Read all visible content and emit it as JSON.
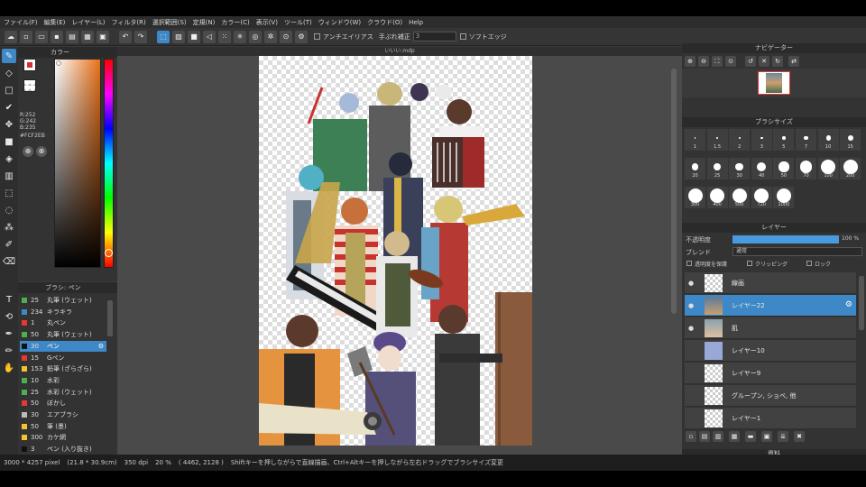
{
  "menu": [
    "ファイル(F)",
    "編集(E)",
    "レイヤー(L)",
    "フィルタ(R)",
    "選択範囲(S)",
    "定規(N)",
    "カラー(C)",
    "表示(V)",
    "ツール(T)",
    "ウィンドウ(W)",
    "クラウド(O)",
    "Help"
  ],
  "toolbar": {
    "antialias_label": "アンチエイリアス",
    "correction_label": "手ぶれ補正",
    "correction_value": "3",
    "soft_edge_label": "ソフトエッジ"
  },
  "color_panel": {
    "title": "カラー",
    "r": "R:252",
    "g": "G:242",
    "b": "B:235",
    "hex": "#FCF2EB",
    "current_color": "#fcf2eb"
  },
  "brush_panel": {
    "title": "ブラシ: ペン",
    "items": [
      {
        "size": "25",
        "name": "丸筆 (ウェット)",
        "color": "#4caf50"
      },
      {
        "size": "234",
        "name": "キラキラ",
        "color": "#3e88c8"
      },
      {
        "size": "1",
        "name": "丸ペン",
        "color": "#e53935"
      },
      {
        "size": "50",
        "name": "丸筆 (ウェット)",
        "color": "#4caf50"
      },
      {
        "size": "30",
        "name": "ペン",
        "color": "#111111"
      },
      {
        "size": "15",
        "name": "Gペン",
        "color": "#e53935"
      },
      {
        "size": "153",
        "name": "鉛筆 (ざらざら)",
        "color": "#f4c430"
      },
      {
        "size": "10",
        "name": "水彩",
        "color": "#4caf50"
      },
      {
        "size": "25",
        "name": "水彩 (ウェット)",
        "color": "#4caf50"
      },
      {
        "size": "50",
        "name": "ぼかし",
        "color": "#e53935"
      },
      {
        "size": "30",
        "name": "エアブラシ",
        "color": "#bbbbbb"
      },
      {
        "size": "50",
        "name": "筆 (墨)",
        "color": "#f4c430"
      },
      {
        "size": "300",
        "name": "カケ網",
        "color": "#f4c430"
      },
      {
        "size": "3",
        "name": "ペン (入り抜き)",
        "color": "#111111"
      }
    ]
  },
  "canvas": {
    "tab_title": "いいい.mdp"
  },
  "navigator": {
    "title": "ナビゲーター"
  },
  "brush_size": {
    "title": "ブラシサイズ",
    "sizes": [
      "1",
      "1.5",
      "2",
      "3",
      "5",
      "7",
      "10",
      "15",
      "20",
      "25",
      "30",
      "40",
      "50",
      "70",
      "100",
      "200",
      "300",
      "400",
      "500",
      "720",
      "1000"
    ]
  },
  "layers": {
    "title": "レイヤー",
    "opacity_label": "不透明度",
    "opacity_value": "100 %",
    "opacity_fraction": 1.0,
    "blend_label": "ブレンド",
    "blend_value": "通常",
    "protect_label": "透明度を保護",
    "clipping_label": "クリッピング",
    "lock_label": "ロック",
    "items": [
      {
        "name": "線画",
        "visible": true,
        "selected": false
      },
      {
        "name": "レイヤー22",
        "visible": true,
        "selected": true
      },
      {
        "name": "肌",
        "visible": true,
        "selected": false
      },
      {
        "name": "レイヤー10",
        "visible": false,
        "selected": false
      },
      {
        "name": "レイヤー9",
        "visible": false,
        "selected": false
      },
      {
        "name": "グループン, ショベ, 他",
        "visible": false,
        "selected": false
      },
      {
        "name": "レイヤー1",
        "visible": false,
        "selected": false
      }
    ]
  },
  "materials": {
    "title": "資料"
  },
  "status": {
    "size": "3000 * 4257 pixel",
    "cm": "(21.8 * 30.9cm)",
    "dpi": "350 dpi",
    "zoom": "20 %",
    "coords": "( 4462, 2128 )",
    "hint": "Shiftキーを押しながらで直線描画、Ctrl+Altキーを押しながら左右ドラッグでブラシサイズ変更"
  },
  "colors": {
    "accent": "#3e88c8",
    "panel": "#333333",
    "canvas_bg": "#4a4a4a"
  }
}
